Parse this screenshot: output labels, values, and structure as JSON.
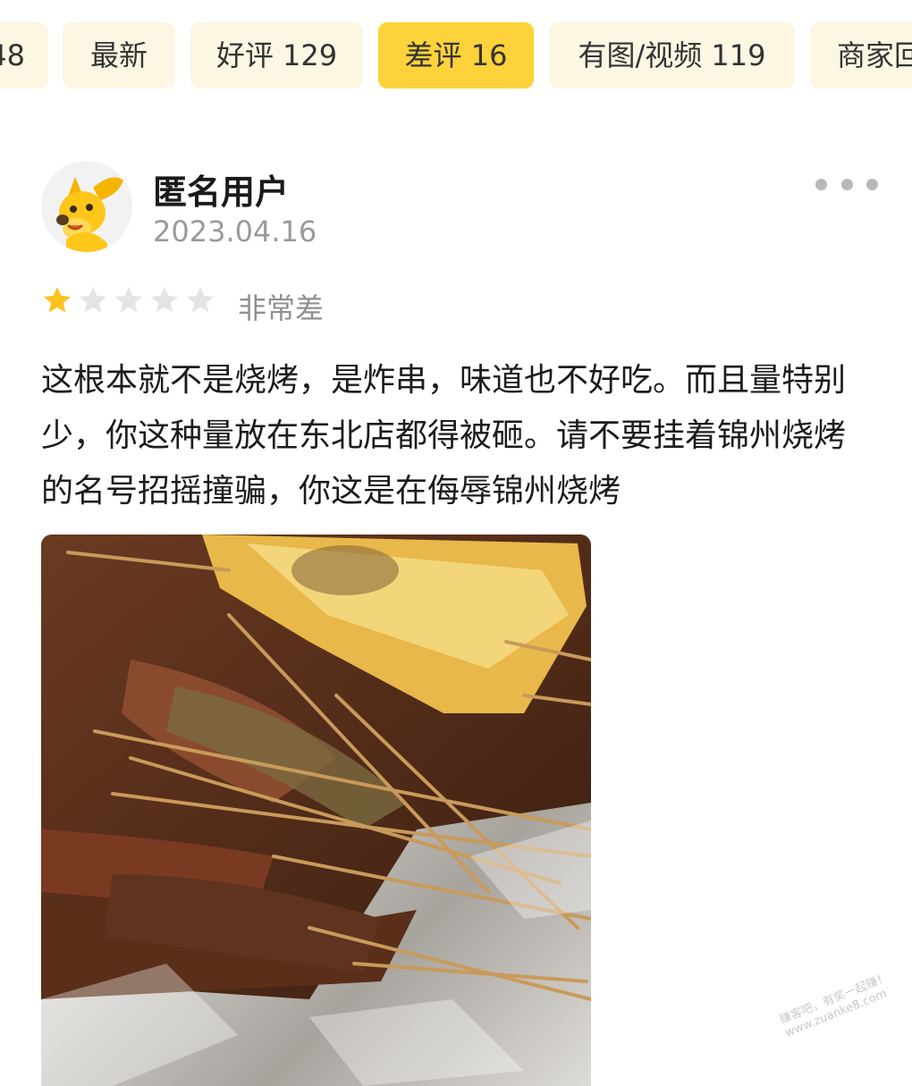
{
  "filter_tabs": [
    {
      "label": "48",
      "active": false
    },
    {
      "label": "最新",
      "active": false
    },
    {
      "label": "好评 129",
      "active": false
    },
    {
      "label": "差评 16",
      "active": true
    },
    {
      "label": "有图/视频 119",
      "active": false
    },
    {
      "label": "商家回",
      "active": false
    }
  ],
  "review": {
    "user_name": "匿名用户",
    "date": "2023.04.16",
    "rating": 1,
    "rating_max": 5,
    "rating_label": "非常差",
    "text": "这根本就不是烧烤，是炸串，味道也不好吃。而且量特别少，你这种量放在东北店都得被砸。请不要挂着锦州烧烤的名号招摇撞骗，你这是在侮辱锦州烧烤"
  },
  "icons": {
    "avatar": "yellow-dog-mascot-icon",
    "more": "more-dots-icon",
    "star_filled": "star-filled-icon",
    "star_empty": "star-empty-icon"
  },
  "colors": {
    "tab_bg": "#fdf6e3",
    "tab_active_bg": "#fdd23a",
    "star_filled": "#fdc21d",
    "star_empty": "#e4e4e4",
    "secondary_text": "#9a9a9a"
  },
  "watermark": {
    "line1": "赚客吧，有奖一起赚！",
    "line2": "www.zuanke8.com"
  }
}
